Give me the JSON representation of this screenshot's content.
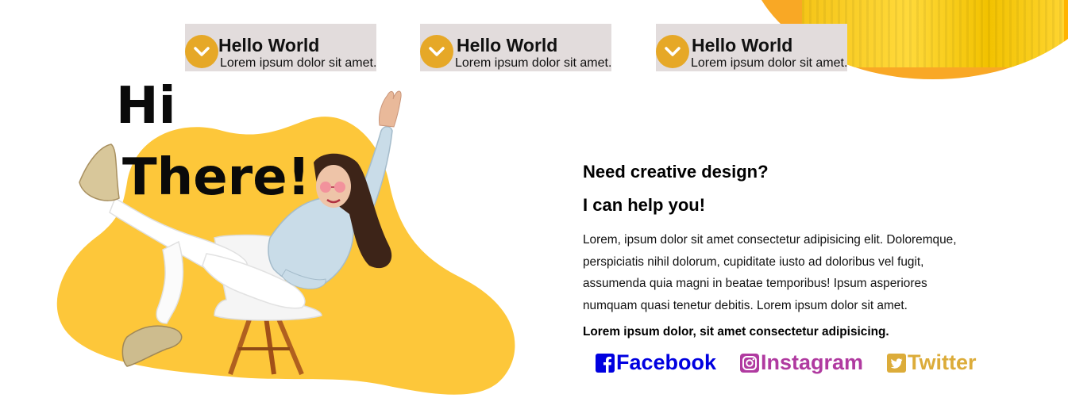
{
  "cards": [
    {
      "title": "Hello World",
      "subtitle": "Lorem ipsum dolor sit amet."
    },
    {
      "title": "Hello World",
      "subtitle": "Lorem ipsum dolor sit amet."
    },
    {
      "title": "Hello World",
      "subtitle": "Lorem ipsum dolor sit amet."
    }
  ],
  "hero": {
    "line1": "Hi",
    "line2": "There!"
  },
  "intro": {
    "heading1": "Need creative design?",
    "heading2": "I can help you!",
    "paragraph": "Lorem, ipsum dolor sit amet consectetur adipisicing elit. Doloremque, perspiciatis nihil dolorum, cupiditate iusto ad doloribus vel fugit, assumenda quia magni in beatae temporibus! Ipsum asperiores numquam quasi tenetur debitis. Lorem ipsum dolor sit amet.",
    "bold_line": "Lorem ipsum dolor, sit amet consectetur adipisicing."
  },
  "social": {
    "facebook": {
      "label": "Facebook",
      "color": "#0000e0",
      "icon": "facebook-icon"
    },
    "instagram": {
      "label": "Instagram",
      "color": "#b03aa0",
      "icon": "instagram-icon"
    },
    "twitter": {
      "label": "Twitter",
      "color": "#dcac3a",
      "icon": "twitter-icon"
    }
  },
  "colors": {
    "accent_yellow": "#fdc73a",
    "card_bg": "#e2dcdc",
    "chevron_bg": "#e6a827"
  }
}
